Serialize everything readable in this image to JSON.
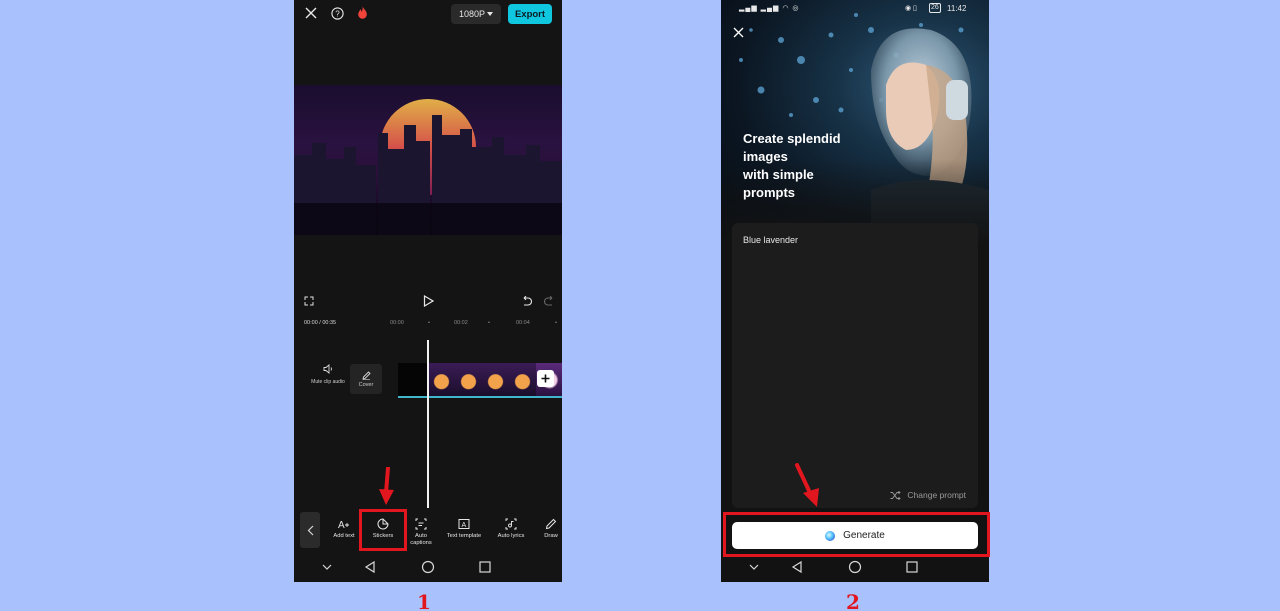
{
  "colors": {
    "background": "#a9c2fd",
    "accent_export": "#10c7e0",
    "highlight_red": "#e2161e"
  },
  "left_phone": {
    "top_bar": {
      "resolution_label": "1080P",
      "export_label": "Export"
    },
    "timeline": {
      "timecode": "00:00 / 00:35",
      "ruler_marks": [
        "00:00",
        "00:02",
        "00:04"
      ],
      "audio_label": "Mute clip audio",
      "cover_label": "Cover"
    },
    "toolbar": {
      "items": [
        "Add text",
        "Stickers",
        "Auto captions",
        "Text template",
        "Auto lyrics",
        "Draw"
      ]
    }
  },
  "right_phone": {
    "status_bar": {
      "time": "11:42",
      "battery": "26"
    },
    "headline": [
      "Create splendid",
      "images",
      "with simple",
      "prompts"
    ],
    "prompt_value": "Blue lavender",
    "change_prompt_label": "Change prompt",
    "generate_label": "Generate"
  },
  "step_labels": [
    "1",
    "2"
  ]
}
